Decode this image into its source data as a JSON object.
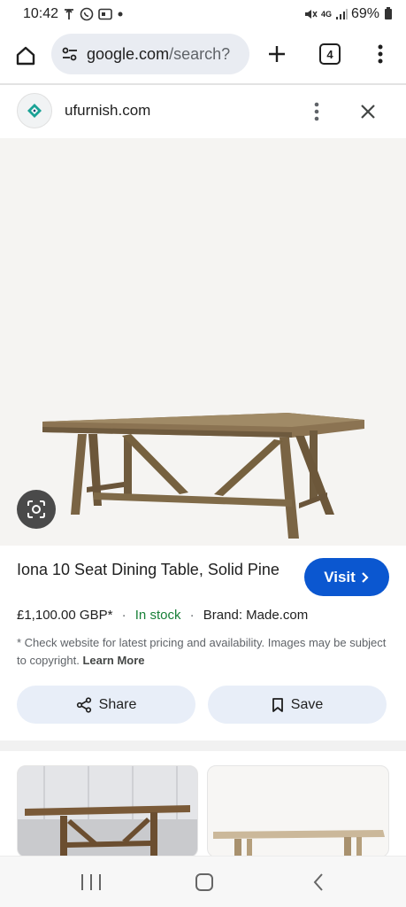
{
  "status_bar": {
    "time": "10:42",
    "network": "4G",
    "battery": "69%"
  },
  "browser": {
    "url_host": "google.com",
    "url_path": "/search?",
    "tab_count": "4"
  },
  "panel": {
    "site_name": "ufurnish.com"
  },
  "product": {
    "title": "Iona 10 Seat Dining Table, Solid Pine",
    "visit_label": "Visit",
    "price": "£1,100.00 GBP*",
    "separator": "·",
    "stock": "In stock",
    "brand": "Brand: Made.com",
    "disclaimer": "* Check website for latest pricing and availability. Images may be subject to copyright.",
    "learn_more": "Learn More",
    "share_label": "Share",
    "save_label": "Save"
  },
  "colors": {
    "accent_blue": "#0b57d0",
    "in_stock_green": "#188038",
    "chip_bg": "#e8eef8"
  }
}
